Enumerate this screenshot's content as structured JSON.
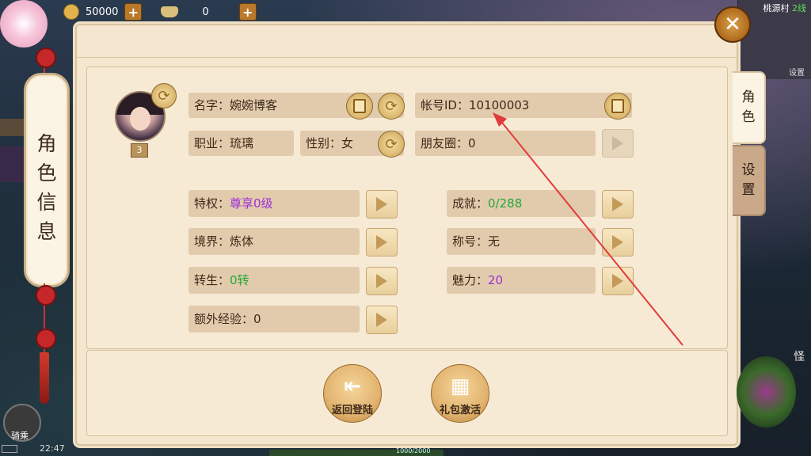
{
  "hud": {
    "coins": "50000",
    "ingots": "0",
    "location": "桃源村",
    "line": "2线",
    "map_setting": "设置",
    "mount_label": "骑乘",
    "clock": "22:47",
    "exp_text": "1000/2000",
    "skill_label": "怪"
  },
  "scroll_title": [
    "角",
    "色",
    "信",
    "息"
  ],
  "tabs": {
    "role": [
      "角",
      "色"
    ],
    "settings": [
      "设",
      "置"
    ]
  },
  "profile": {
    "level": "3",
    "name_label": "名字：",
    "name": "婉婉博客",
    "account_label": "帐号ID：",
    "account_id": "10100003",
    "job_label": "职业：",
    "job": "琉璃",
    "gender_label": "性别：",
    "gender": "女",
    "friends_label": "朋友圈：",
    "friends": "0"
  },
  "stats": {
    "privilege_label": "特权：",
    "privilege": "尊享0级",
    "achievement_label": "成就：",
    "achievement": "0/288",
    "realm_label": "境界：",
    "realm": "炼体",
    "title_label": "称号：",
    "title": "无",
    "rebirth_label": "转生：",
    "rebirth": "0转",
    "charm_label": "魅力：",
    "charm": "20",
    "extra_exp_label": "额外经验：",
    "extra_exp": "0"
  },
  "actions": {
    "back_login": "返回登陆",
    "gift_activate": "礼包激活"
  },
  "colors": {
    "purple_value": "#9b30d8",
    "green_value": "#22a83a",
    "panel_bg": "#f4e6cf",
    "field_bg": "#e2cbac",
    "annotation_arrow": "#e23a3a"
  }
}
